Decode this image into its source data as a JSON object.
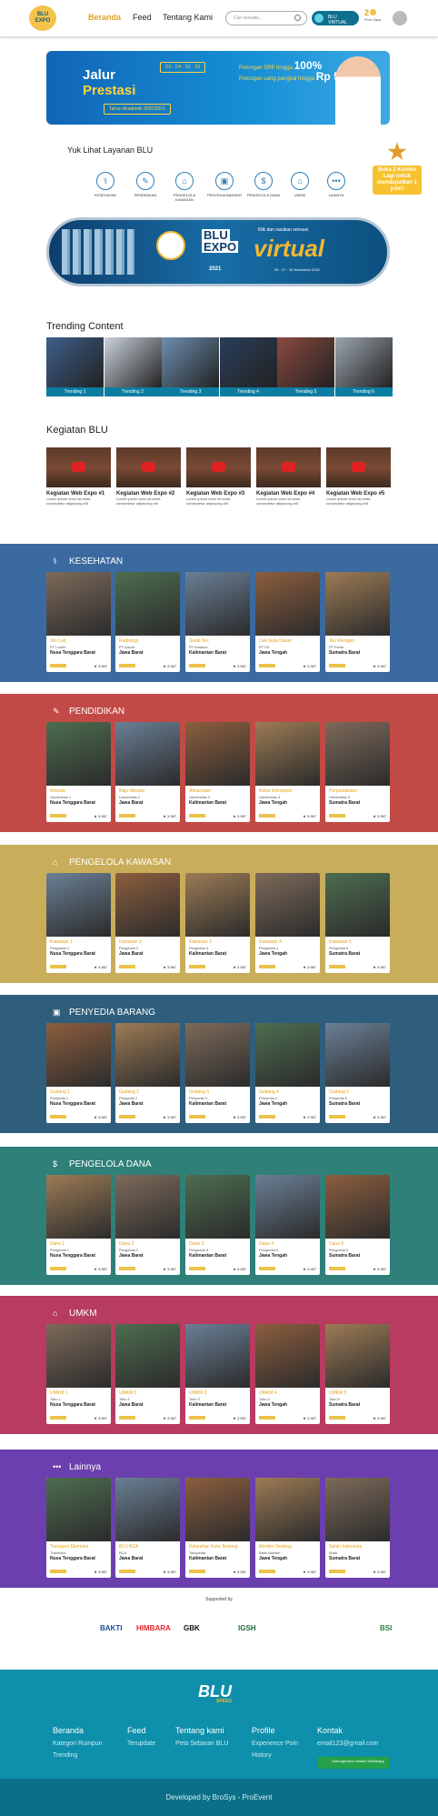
{
  "nav": {
    "logo_text": "BLU EXPO",
    "links": [
      "Beranda",
      "Feed",
      "Tentang Kami"
    ],
    "search_placeholder": "Cari sesuatu...",
    "virtual_label": "BLU VIRTUAL",
    "points": "2",
    "points_label": "Poin Saya"
  },
  "banner": {
    "title1": "Jalur",
    "title2": "Prestasi",
    "chip1": "D3 · D4 · S1 · S2",
    "chip2": "Tahun Akademik 2020/2021",
    "line1": "Potongan SPP hingga",
    "line1b": "100%",
    "line2": "Potongan uang pangkal hingga",
    "line2b": "Rp 5 JT"
  },
  "services": {
    "title": "Yuk Lihat Layanan BLU",
    "items": [
      "KESEHATAN",
      "PENDIDIKAN",
      "PENGELOLA KAWASAN",
      "PENYEDIA BARANG",
      "PENGELOLA DANA",
      "UMKM",
      "LAINNYA"
    ]
  },
  "badge": "Buka 2 Konten Lagi untuk mendapatkan 1 poin!",
  "expo": {
    "title": "BLU",
    "title2": "EXPO",
    "virtual": "virtual",
    "year": "2021",
    "tag": "Klik dan rasakan sensasi",
    "dates": "29 · 27 · 30 November 2021"
  },
  "trending": {
    "title": "Trending Content",
    "items": [
      "Trending 1",
      "Trending 2",
      "Trending 3",
      "Trending 4",
      "Trending 5",
      "Trending 6"
    ]
  },
  "kegiatan": {
    "title": "Kegiatan BLU",
    "items": [
      {
        "t": "Kegiatan Web Expo #1",
        "d": "Lorem ipsum dolor sit amet, consectetur adipiscing elit"
      },
      {
        "t": "Kegiatan Web Expo #2",
        "d": "Lorem ipsum dolor sit amet, consectetur adipiscing elit"
      },
      {
        "t": "Kegiatan Web Expo #3",
        "d": "Lorem ipsum dolor sit amet, consectetur adipiscing elit"
      },
      {
        "t": "Kegiatan Web Expo #4",
        "d": "Lorem ipsum dolor sit amet, consectetur adipiscing elit"
      },
      {
        "t": "Kegiatan Web Expo #5",
        "d": "Lorem ipsum dolor sit amet, consectetur adipiscing elit"
      }
    ]
  },
  "categories": [
    {
      "name": "KESEHATAN",
      "icon": "⚕",
      "color": "#3b6aa0",
      "cards": [
        [
          "Tes Lab",
          "PT Lorem",
          "Nusa Tenggara Barat"
        ],
        [
          "Radiologi",
          "PT Ipsum",
          "Jawa Barat"
        ],
        [
          "Swab Tes",
          "PT Amazon",
          "Kalimantan Barat"
        ],
        [
          "Cek Gula Darah",
          "PT CK",
          "Jawa Tengah"
        ],
        [
          "Tes Rontgen",
          "PT Fimer",
          "Sumatra Barat"
        ]
      ]
    },
    {
      "name": "PENDIDIKAN",
      "icon": "✎",
      "color": "#c24a46",
      "cards": [
        [
          "Wisuda",
          "Universitas 1",
          "Nusa Tenggara Barat"
        ],
        [
          "Baju Wisuda",
          "Universitas 2",
          "Jawa Barat"
        ],
        [
          "Almamater",
          "Universitas 3",
          "Kalimantan Barat"
        ],
        [
          "Kelas Kelompok",
          "Universitas 4",
          "Jawa Tengah"
        ],
        [
          "Perpustakaan",
          "Universitas 5",
          "Sumatra Barat"
        ]
      ]
    },
    {
      "name": "PENGELOLA KAWASAN",
      "icon": "⌂",
      "color": "#c9ad5a",
      "cards": [
        [
          "Kawasan 1",
          "Pengelola 1",
          "Nusa Tenggara Barat"
        ],
        [
          "Kawasan 2",
          "Pengelola 2",
          "Jawa Barat"
        ],
        [
          "Kawasan 3",
          "Pengelola 3",
          "Kalimantan Barat"
        ],
        [
          "Kawasan 4",
          "Pengelola 4",
          "Jawa Tengah"
        ],
        [
          "Kawasan 5",
          "Pengelola 5",
          "Sumatra Barat"
        ]
      ]
    },
    {
      "name": "PENYEDIA BARANG",
      "icon": "▣",
      "color": "#2f5d7c",
      "cards": [
        [
          "Gudang 1",
          "Penyedia 1",
          "Nusa Tenggara Barat"
        ],
        [
          "Gudang 2",
          "Penyedia 2",
          "Jawa Barat"
        ],
        [
          "Gudang 3",
          "Penyedia 3",
          "Kalimantan Barat"
        ],
        [
          "Gudang 4",
          "Penyedia 4",
          "Jawa Tengah"
        ],
        [
          "Gudang 5",
          "Penyedia 5",
          "Sumatra Barat"
        ]
      ]
    },
    {
      "name": "PENGELOLA DANA",
      "icon": "$",
      "color": "#2e8079",
      "cards": [
        [
          "Dana 1",
          "Pengelola 1",
          "Nusa Tenggara Barat"
        ],
        [
          "Dana 2",
          "Pengelola 2",
          "Jawa Barat"
        ],
        [
          "Dana 3",
          "Pengelola 3",
          "Kalimantan Barat"
        ],
        [
          "Dana 4",
          "Pengelola 4",
          "Jawa Tengah"
        ],
        [
          "Dana 5",
          "Pengelola 5",
          "Sumatra Barat"
        ]
      ]
    },
    {
      "name": "UMKM",
      "icon": "⌂",
      "color": "#b83b60",
      "cards": [
        [
          "UMKM 1",
          "Toko 1",
          "Nusa Tenggara Barat"
        ],
        [
          "UMKM 2",
          "Toko 2",
          "Jawa Barat"
        ],
        [
          "UMKM 3",
          "Toko 3",
          "Kalimantan Barat"
        ],
        [
          "UMKM 4",
          "Toko 4",
          "Jawa Tengah"
        ],
        [
          "UMKM 5",
          "Toko 5",
          "Sumatra Barat"
        ]
      ]
    },
    {
      "name": "Lainnya",
      "icon": "•••",
      "color": "#6b3fae",
      "cards": [
        [
          "Transport Ekonomi",
          "Traveloka",
          "Nusa Tenggara Barat"
        ],
        [
          "BLU BCA",
          "BCA",
          "Jawa Barat"
        ],
        [
          "Kelurahan Kota Tentang",
          "Tokopedia",
          "Kalimantan Barat"
        ],
        [
          "Menteri Tentang",
          "Bank Mandiri",
          "Jawa Tengah"
        ],
        [
          "Santri Indonesia",
          "Bnak",
          "Sumatra Barat"
        ]
      ]
    }
  ],
  "card_rating": "★ 3.987",
  "card_meta": "◷ 2 Hari",
  "sponsor_title": "Supported by",
  "sponsors": [
    "BAKTI",
    "HIMBARA",
    "GBK",
    "IGSH",
    "BSI"
  ],
  "footer": {
    "logo": "BLU",
    "logo_sub": "SPEED",
    "cols": [
      {
        "h": "Beranda",
        "items": [
          "Kategori Rumpun",
          "Trending"
        ]
      },
      {
        "h": "Feed",
        "items": [
          "Terupdate"
        ]
      },
      {
        "h": "Tentang kami",
        "items": [
          "Peta Sebaran BLU"
        ]
      },
      {
        "h": "Profile",
        "items": [
          "Experience Poin",
          "History"
        ]
      },
      {
        "h": "Kontak",
        "items": [
          "email123@gmail.com"
        ]
      }
    ],
    "wa": "Hubungi kami melalui WhatsApp",
    "bottom": "Developed by BroSys - ProEvent"
  }
}
